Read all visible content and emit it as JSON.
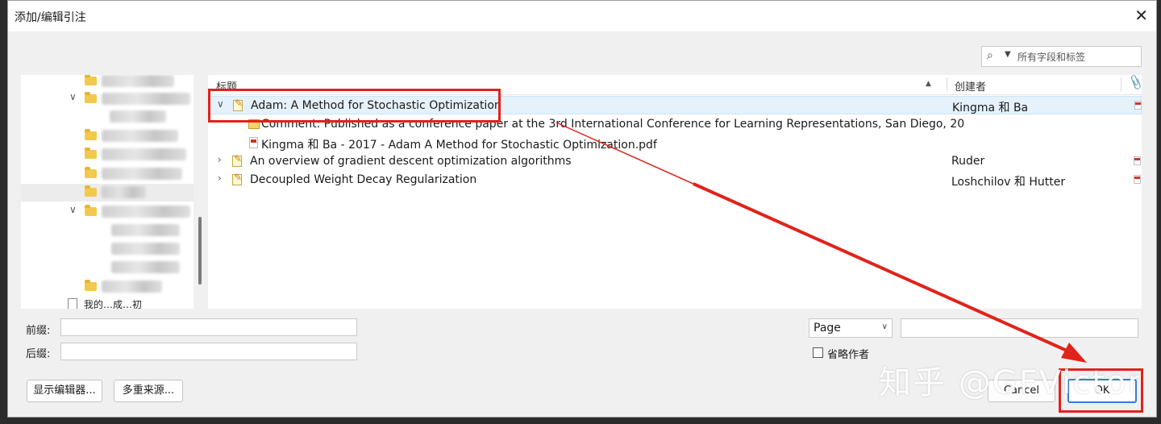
{
  "window": {
    "title": "添加/编辑引注",
    "close_glyph": "✕"
  },
  "search": {
    "placeholder": "所有字段和标签",
    "icon": "search-icon"
  },
  "list": {
    "columns": {
      "title": "标题",
      "creator": "创建者",
      "sort_glyph": "▲",
      "attachment_glyph": "📎"
    },
    "rows": [
      {
        "title": "Adam: A Method for Stochastic Optimization",
        "creator": "Kingma 和 Ba",
        "expanded": true,
        "has_pdf": true
      },
      {
        "title": "Comment: Published as a conference paper at the 3rd International Conference for Learning Representations, San Diego, 20",
        "kind": "note"
      },
      {
        "title": "Kingma 和 Ba - 2017 - Adam A Method for Stochastic Optimization.pdf",
        "kind": "pdf"
      },
      {
        "title": "An overview of gradient descent optimization algorithms",
        "creator": "Ruder",
        "has_pdf": true
      },
      {
        "title": "Decoupled Weight Decay Regularization",
        "creator": "Loshchilov 和 Hutter",
        "has_pdf": true
      }
    ]
  },
  "left_pane": {
    "library_label": "我的…成…初"
  },
  "form": {
    "prefix_label": "前缀:",
    "suffix_label": "后缀:",
    "prefix_value": "",
    "suffix_value": "",
    "locator_selected": "Page",
    "locator_value": "",
    "omit_author_label": "省略作者",
    "omit_author_checked": false
  },
  "buttons": {
    "show_editor": "显示编辑器...",
    "multiple_sources": "多重来源...",
    "cancel": "Cancel",
    "ok": "OK"
  },
  "watermark": "知乎 @GFVictor",
  "colors": {
    "annotation_red": "#e0231b",
    "selection_blue": "#e5f1fb",
    "folder_yellow": "#f2c94c"
  }
}
